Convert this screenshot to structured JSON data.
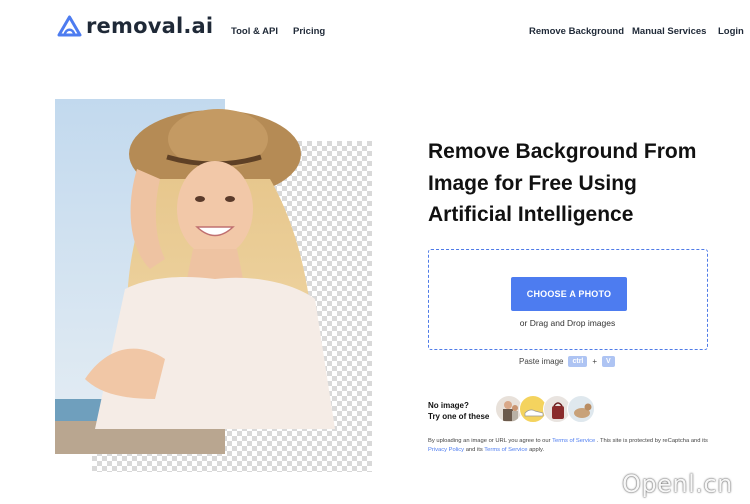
{
  "header": {
    "logo_text": "removal.ai",
    "nav_left": [
      "Tool & API",
      "Pricing"
    ],
    "nav_right": [
      "Remove Background",
      "Manual Services",
      "Login"
    ]
  },
  "hero": {
    "headline_lines": [
      "Remove Background From",
      "Image for Free Using",
      "Artificial Intelligence"
    ]
  },
  "upload": {
    "button_label": "CHOOSE A PHOTO",
    "drag_text": "or Drag and Drop images",
    "paste_label": "Paste image",
    "paste_key_1": "ctrl",
    "paste_plus": "+",
    "paste_key_2": "V"
  },
  "samples": {
    "prompt_line1": "No image?",
    "prompt_line2": "Try one of these",
    "items": [
      "sample-person",
      "sample-shoes",
      "sample-bag",
      "sample-dog"
    ]
  },
  "terms": {
    "t1": "By uploading an image or URL you agree to our ",
    "link1": "Terms of Service",
    "t2": " . This site is protected by reCaptcha and its ",
    "link2": "Privacy Policy",
    "t3": " and its ",
    "link3": "Terms of Service",
    "t4": " apply."
  },
  "watermark": "Openl.cn",
  "colors": {
    "accent": "#4d7cf0",
    "dropzone_border": "#4f7be8",
    "key_bg": "#aec4f3"
  }
}
